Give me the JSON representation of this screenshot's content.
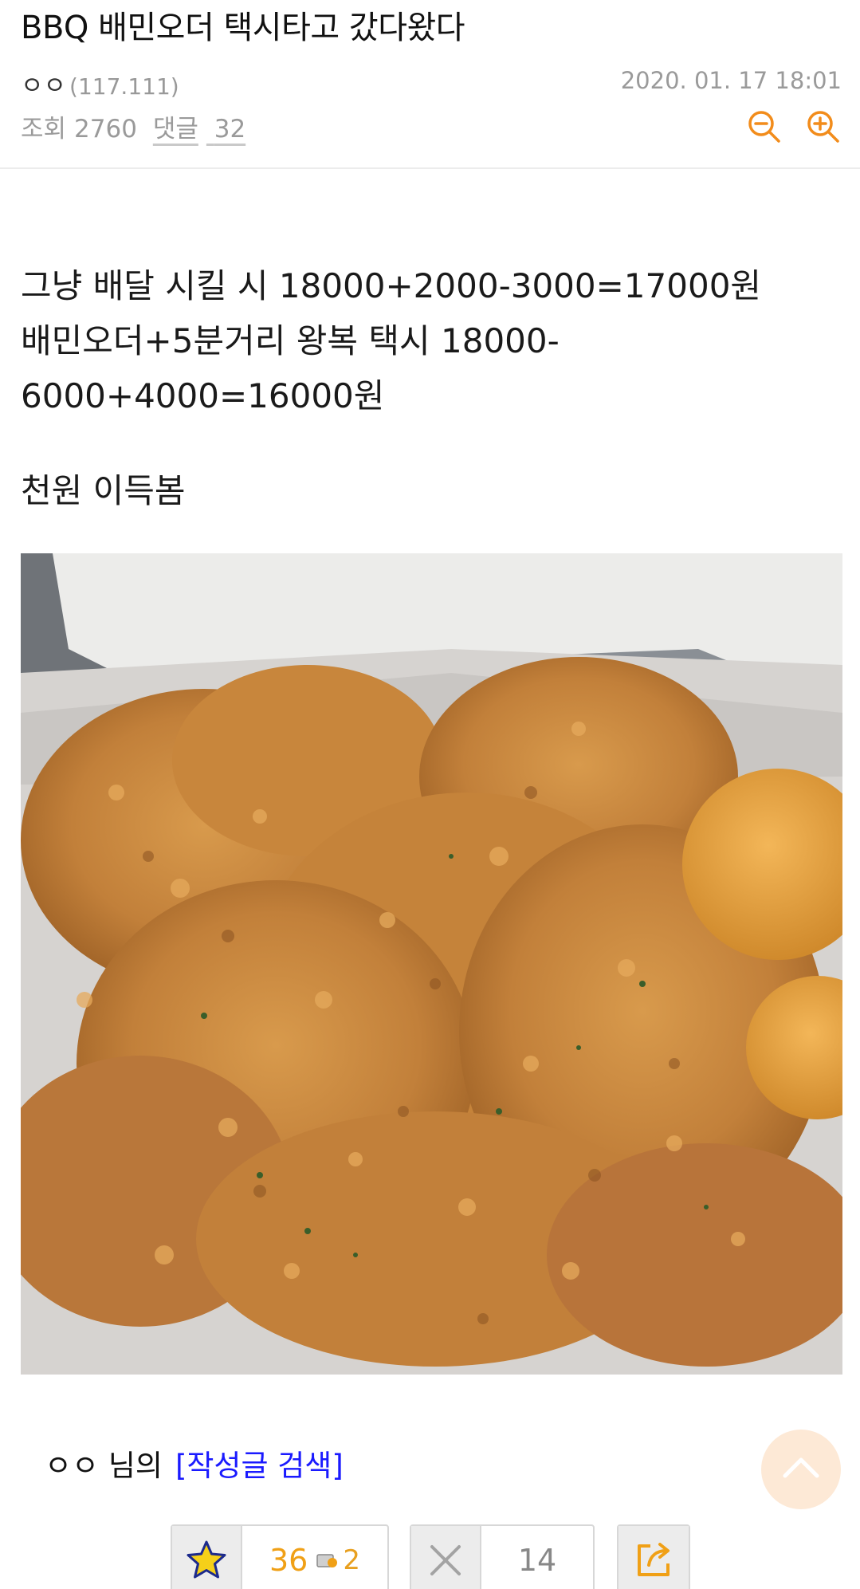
{
  "post": {
    "title": "BBQ 배민오더 택시타고 갔다왔다",
    "author": "ㅇㅇ",
    "ip": "(117.111)",
    "date": "2020. 01. 17 18:01",
    "views_label": "조회",
    "views": "2760",
    "comments_label": "댓글",
    "comments": "32"
  },
  "body": {
    "line1": "그냥 배달 시킬 시 18000+2000-3000=17000원",
    "line2": "배민오더+5분거리 왕복 택시 18000-",
    "line3": "6000+4000=16000원",
    "line4": "천원 이득봄"
  },
  "author_search": {
    "name": "ㅇㅇ",
    "suffix": "님의",
    "link_label": "[작성글 검색]"
  },
  "votes": {
    "recommend": "36",
    "fixed_recommend": "2",
    "not_recommend": "14"
  },
  "colors": {
    "accent_orange": "#f0a016",
    "link_blue": "#1a1aff",
    "meta_gray": "#9a9a9a"
  },
  "icons": [
    "zoom-out-icon",
    "zoom-in-icon",
    "star-icon",
    "fixed-recommend-icon",
    "x-icon",
    "share-icon",
    "chevron-up-icon"
  ]
}
